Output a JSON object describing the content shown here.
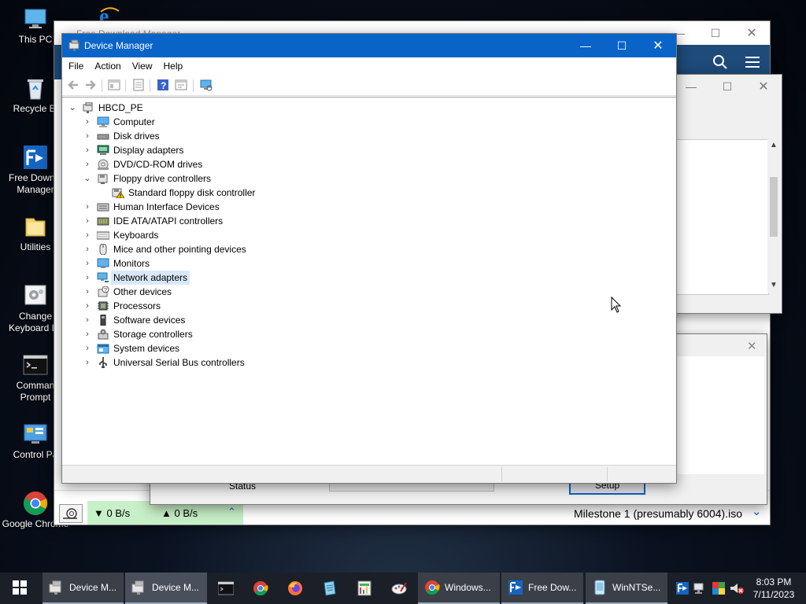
{
  "desktop": {
    "icons": [
      {
        "label": "This PC",
        "icon": "computer-icon"
      },
      {
        "label": "Recycle Bi",
        "icon": "recycle-bin-icon"
      },
      {
        "label": "Free Downlo Manager",
        "icon": "free-download-manager-icon"
      },
      {
        "label": "Utilities",
        "icon": "folder-icon"
      },
      {
        "label": "Change Keyboard La",
        "icon": "keyboard-settings-icon"
      },
      {
        "label": "Comman Prompt",
        "icon": "command-prompt-icon"
      },
      {
        "label": "Control Pa",
        "icon": "control-panel-icon"
      },
      {
        "label": "Google Chrome",
        "icon": "chrome-icon"
      }
    ]
  },
  "fdm_window": {
    "title": "Free Download Manager",
    "speed_down": "▼ 0 B/s",
    "speed_up": "▲ 0 B/s",
    "current_file": "Milestone 1 (presumably 6004).iso"
  },
  "dialog_window": {
    "status_label": "Status",
    "setup_label": "Setup"
  },
  "device_manager": {
    "title": "Device Manager",
    "menu": [
      "File",
      "Action",
      "View",
      "Help"
    ],
    "root": "HBCD_PE",
    "categories": [
      {
        "label": "Computer",
        "icon": "computer-icon",
        "expanded": false
      },
      {
        "label": "Disk drives",
        "icon": "disk-drive-icon",
        "expanded": false
      },
      {
        "label": "Display adapters",
        "icon": "display-adapter-icon",
        "expanded": false
      },
      {
        "label": "DVD/CD-ROM drives",
        "icon": "dvd-drive-icon",
        "expanded": false
      },
      {
        "label": "Floppy drive controllers",
        "icon": "floppy-controller-icon",
        "expanded": true,
        "children": [
          "Standard floppy disk controller"
        ]
      },
      {
        "label": "Human Interface Devices",
        "icon": "hid-icon",
        "expanded": false
      },
      {
        "label": "IDE ATA/ATAPI controllers",
        "icon": "ide-controller-icon",
        "expanded": false
      },
      {
        "label": "Keyboards",
        "icon": "keyboard-icon",
        "expanded": false
      },
      {
        "label": "Mice and other pointing devices",
        "icon": "mouse-icon",
        "expanded": false
      },
      {
        "label": "Monitors",
        "icon": "monitor-icon",
        "expanded": false
      },
      {
        "label": "Network adapters",
        "icon": "network-adapter-icon",
        "expanded": false,
        "selected": true
      },
      {
        "label": "Other devices",
        "icon": "unknown-device-icon",
        "expanded": false
      },
      {
        "label": "Processors",
        "icon": "processor-icon",
        "expanded": false
      },
      {
        "label": "Software devices",
        "icon": "software-device-icon",
        "expanded": false
      },
      {
        "label": "Storage controllers",
        "icon": "storage-controller-icon",
        "expanded": false
      },
      {
        "label": "System devices",
        "icon": "system-device-icon",
        "expanded": false
      },
      {
        "label": "Universal Serial Bus controllers",
        "icon": "usb-icon",
        "expanded": false
      }
    ]
  },
  "taskbar": {
    "buttons": [
      {
        "label": "Device M...",
        "icon": "device-manager-icon"
      },
      {
        "label": "Device M...",
        "icon": "device-manager-icon"
      },
      {
        "label": "",
        "icon": "command-prompt-icon"
      },
      {
        "label": "",
        "icon": "chrome-icon"
      },
      {
        "label": "",
        "icon": "firefox-icon"
      },
      {
        "label": "",
        "icon": "notepad-icon"
      },
      {
        "label": "",
        "icon": "task-icon"
      },
      {
        "label": "",
        "icon": "paint-icon"
      },
      {
        "label": "Windows...",
        "icon": "chrome-icon"
      },
      {
        "label": "Free Dow...",
        "icon": "free-download-manager-icon"
      },
      {
        "label": "WinNTSe...",
        "icon": "winntsetup-icon"
      }
    ],
    "clock_time": "8:03 PM",
    "clock_date": "7/11/2023"
  },
  "colors": {
    "titlebar_active": "#0a64c8",
    "selection": "#d9e8f9",
    "taskbar": "#1b1f27",
    "fdm_green": "#c8f0c8"
  }
}
